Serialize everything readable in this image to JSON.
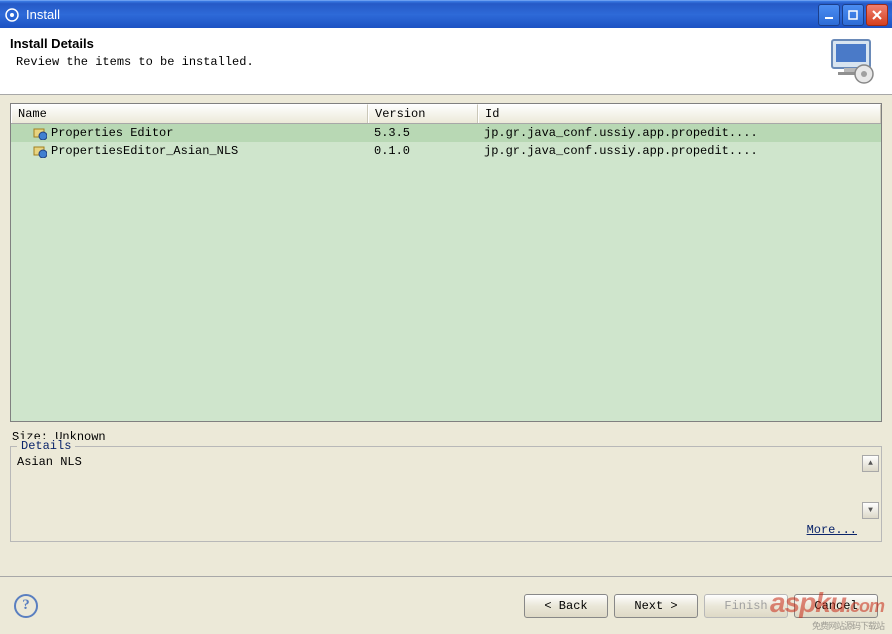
{
  "titlebar": {
    "title": "Install"
  },
  "banner": {
    "title": "Install Details",
    "subtitle": "Review the items to be installed."
  },
  "columns": {
    "name": "Name",
    "version": "Version",
    "id": "Id"
  },
  "rows": [
    {
      "name": "Properties Editor",
      "version": "5.3.5",
      "id": "jp.gr.java_conf.ussiy.app.propedit....",
      "selected": true
    },
    {
      "name": "PropertiesEditor_Asian_NLS",
      "version": "0.1.0",
      "id": "jp.gr.java_conf.ussiy.app.propedit....",
      "selected": false
    }
  ],
  "size": {
    "label": "Size:",
    "value": "Unknown"
  },
  "details": {
    "legend": "Details",
    "text": "Asian NLS",
    "more": "More..."
  },
  "buttons": {
    "back": "< Back",
    "next": "Next >",
    "finish": "Finish",
    "cancel": "Cancel"
  },
  "watermark": {
    "main": "aspku",
    "suffix": ".com",
    "sub": "免费网站源码下载站"
  }
}
